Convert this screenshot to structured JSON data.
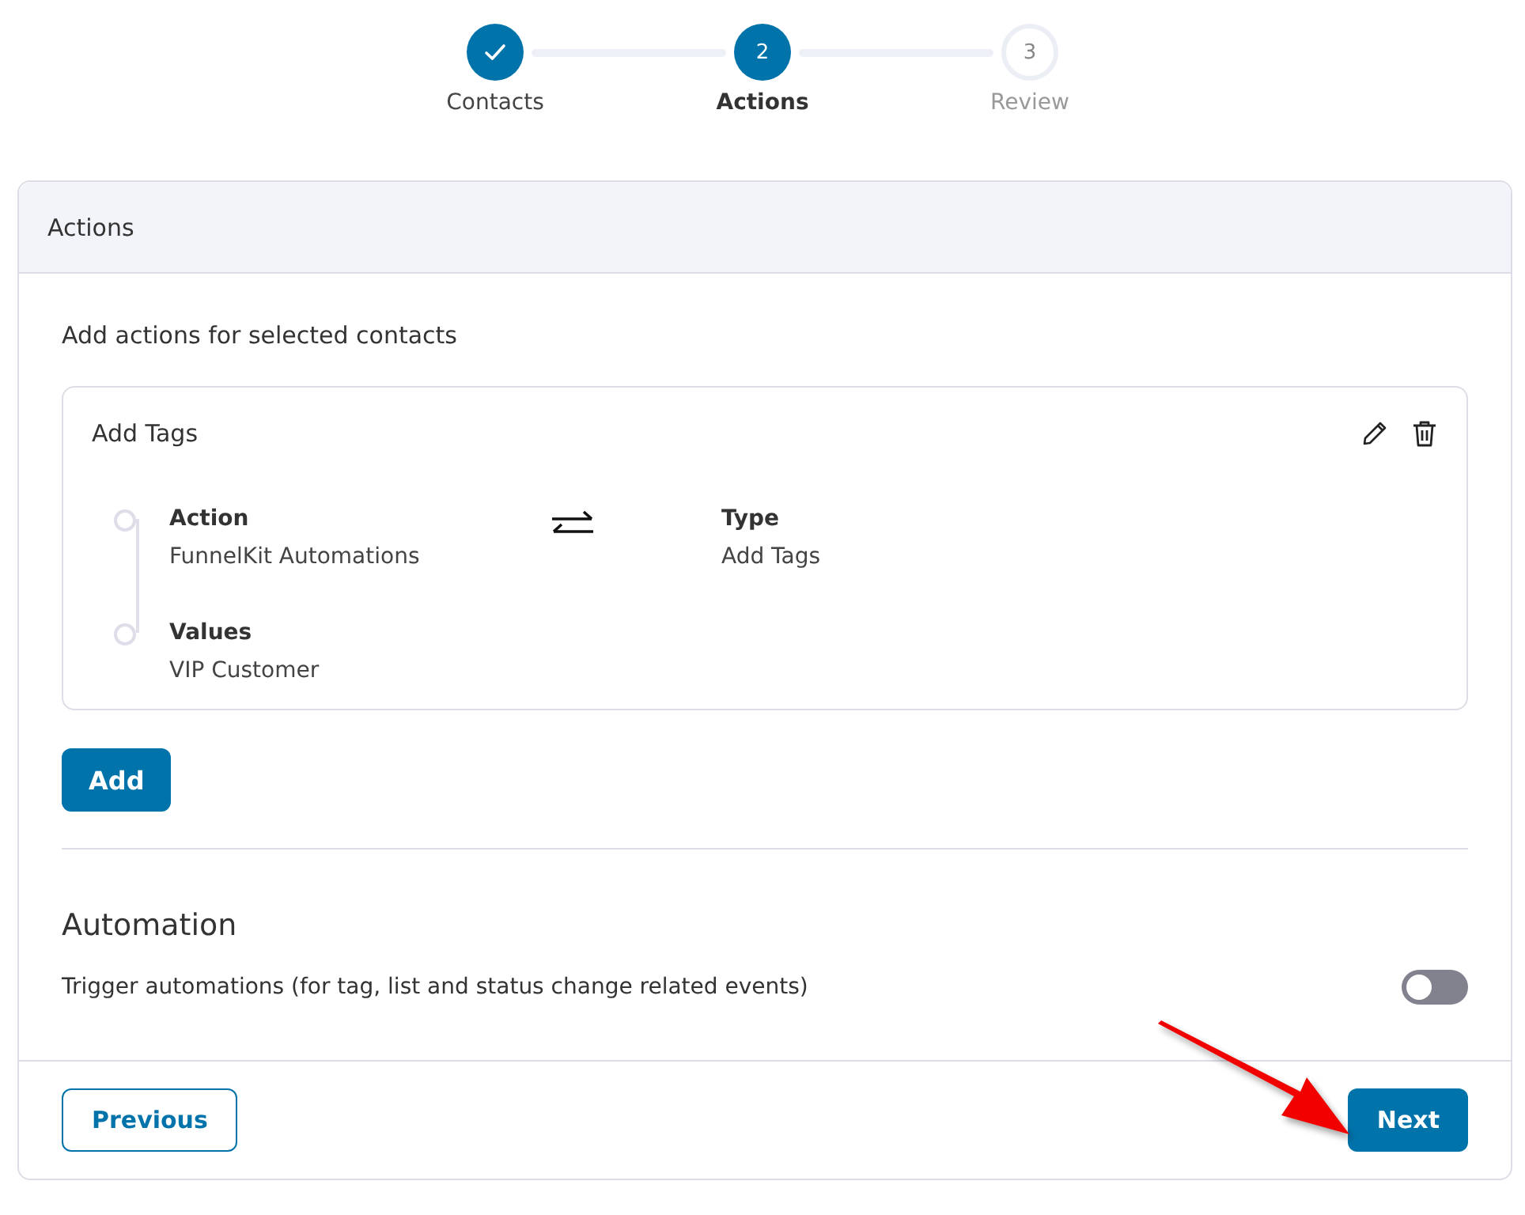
{
  "steps": [
    {
      "label": "Contacts",
      "completed": true,
      "selected": false
    },
    {
      "number": "2",
      "label": "Actions",
      "completed": false,
      "selected": true
    },
    {
      "number": "3",
      "label": "Review",
      "completed": false,
      "selected": false
    }
  ],
  "panel": {
    "title": "Actions",
    "subtitle": "Add actions for selected contacts",
    "action_card": {
      "title": "Add Tags",
      "fields": [
        {
          "label": "Action",
          "value": "FunnelKit Automations"
        },
        {
          "label": "Values",
          "value": "VIP Customer"
        }
      ],
      "side_field": {
        "label": "Type",
        "value": "Add Tags"
      }
    },
    "add_button": "Add",
    "automation": {
      "heading": "Automation",
      "label": "Trigger automations (for tag, list and status change related events)",
      "on": false
    }
  },
  "footer": {
    "previous": "Previous",
    "next": "Next"
  }
}
